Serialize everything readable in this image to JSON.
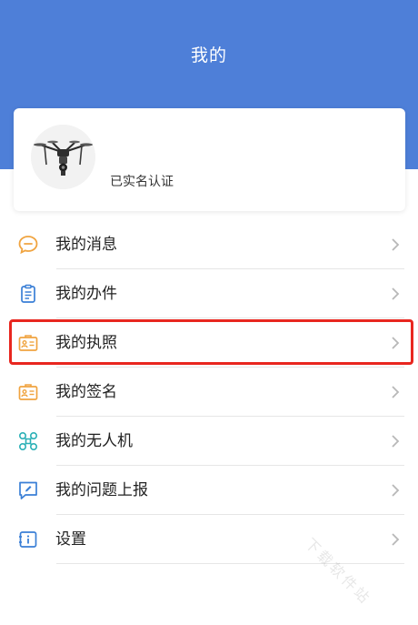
{
  "header": {
    "title": "我的"
  },
  "profile": {
    "verify_status": "已实名认证"
  },
  "menu": {
    "items": [
      {
        "label": "我的消息",
        "icon": "chat-bubble-icon"
      },
      {
        "label": "我的办件",
        "icon": "clipboard-icon"
      },
      {
        "label": "我的执照",
        "icon": "license-card-icon"
      },
      {
        "label": "我的签名",
        "icon": "signature-card-icon"
      },
      {
        "label": "我的无人机",
        "icon": "drone-icon"
      },
      {
        "label": "我的问题上报",
        "icon": "report-icon"
      },
      {
        "label": "设置",
        "icon": "settings-icon"
      }
    ]
  },
  "colors": {
    "header_bg": "#4e7fd8",
    "highlight_border": "#e8261f",
    "icon_orange": "#f0a440",
    "icon_blue": "#3a7fd6",
    "icon_teal": "#2bb0b6"
  },
  "watermark": "下载软件站"
}
